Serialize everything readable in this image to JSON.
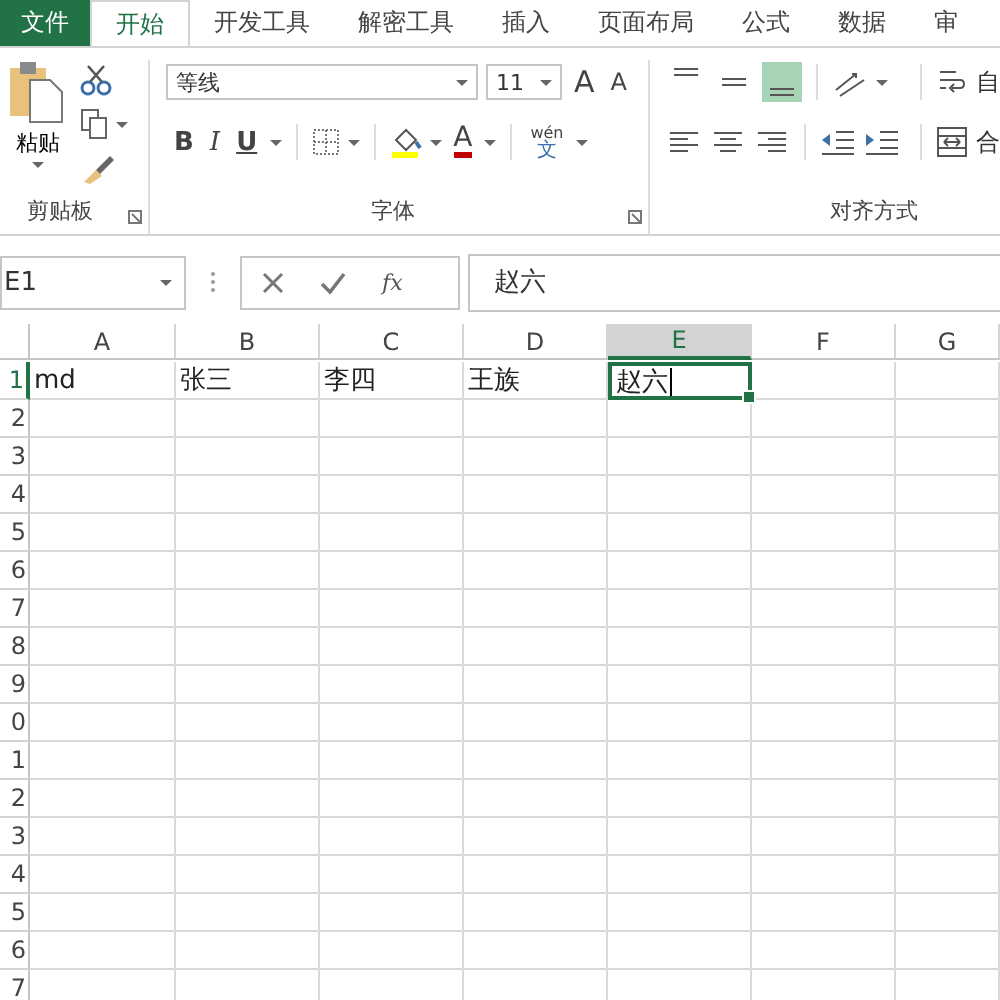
{
  "tabs": [
    {
      "label": "文件",
      "kind": "file",
      "selected": false
    },
    {
      "label": "开始",
      "kind": "tab",
      "selected": true
    },
    {
      "label": "开发工具",
      "kind": "tab",
      "selected": false
    },
    {
      "label": "解密工具",
      "kind": "tab",
      "selected": false
    },
    {
      "label": "插入",
      "kind": "tab",
      "selected": false
    },
    {
      "label": "页面布局",
      "kind": "tab",
      "selected": false
    },
    {
      "label": "公式",
      "kind": "tab",
      "selected": false
    },
    {
      "label": "数据",
      "kind": "tab",
      "selected": false
    },
    {
      "label": "审",
      "kind": "tab",
      "selected": false
    }
  ],
  "clipboard": {
    "paste_label": "粘贴",
    "group_label": "剪贴板"
  },
  "font": {
    "font_name": "等线",
    "font_size": "11",
    "grow": "A",
    "shrink": "A",
    "bold": "B",
    "italic": "I",
    "underline": "U",
    "font_color": "A",
    "pinyin_top": "wén",
    "pinyin_bottom": "文",
    "group_label": "字体"
  },
  "alignment": {
    "vertical": [
      {
        "kind": "top",
        "selected": false
      },
      {
        "kind": "middle",
        "selected": false
      },
      {
        "kind": "bottom",
        "selected": true
      }
    ],
    "horizontal": [
      {
        "kind": "left",
        "selected": false
      },
      {
        "kind": "center",
        "selected": false
      },
      {
        "kind": "right",
        "selected": false
      }
    ],
    "wrap_label": "自",
    "merge_label": "合",
    "group_label": "对齐方式"
  },
  "formula_bar": {
    "name_box": "E1",
    "function_label": "fx",
    "formula": "赵六"
  },
  "sheet": {
    "columns": [
      {
        "label": "A",
        "selected": false
      },
      {
        "label": "B",
        "selected": false
      },
      {
        "label": "C",
        "selected": false
      },
      {
        "label": "D",
        "selected": false
      },
      {
        "label": "E",
        "selected": true
      },
      {
        "label": "F",
        "selected": false
      },
      {
        "label": "G",
        "selected": false
      }
    ],
    "rows": [
      {
        "number": "1",
        "selected": true,
        "cells": [
          {
            "text": "md",
            "selected": false,
            "editing": false
          },
          {
            "text": "张三",
            "selected": false,
            "editing": false
          },
          {
            "text": "李四",
            "selected": false,
            "editing": false
          },
          {
            "text": "王族",
            "selected": false,
            "editing": false
          },
          {
            "text": "赵六",
            "selected": true,
            "editing": true
          }
        ]
      },
      {
        "number": "2",
        "selected": false
      },
      {
        "number": "3",
        "selected": false
      },
      {
        "number": "4",
        "selected": false
      },
      {
        "number": "5",
        "selected": false
      },
      {
        "number": "6",
        "selected": false
      },
      {
        "number": "7",
        "selected": false
      },
      {
        "number": "8",
        "selected": false
      },
      {
        "number": "9",
        "selected": false
      },
      {
        "number": "0",
        "selected": false
      },
      {
        "number": "1",
        "selected": false
      },
      {
        "number": "2",
        "selected": false
      },
      {
        "number": "3",
        "selected": false
      },
      {
        "number": "4",
        "selected": false
      },
      {
        "number": "5",
        "selected": false
      },
      {
        "number": "6",
        "selected": false
      },
      {
        "number": "7",
        "selected": false
      }
    ]
  }
}
